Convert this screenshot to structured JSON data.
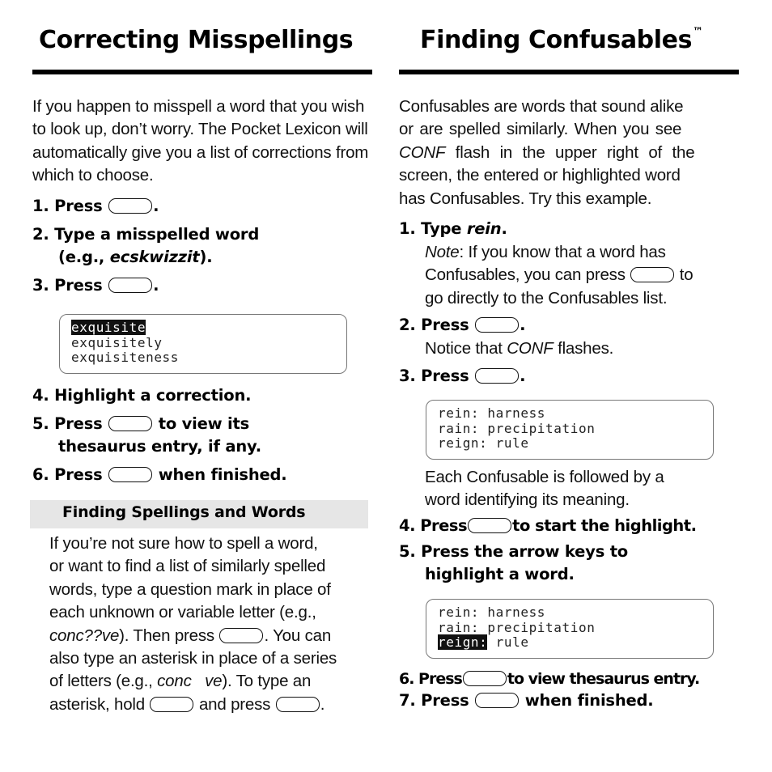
{
  "left": {
    "title": "Correcting Misspellings",
    "intro": "If you happen to misspell a word that you wish to look up, don’t worry. The Pocket Lexicon will automatically give you a list of corrections from which to choose.",
    "steps": {
      "s1_prefix": "1. Press",
      "s1_suffix": ".",
      "s2_line1": "2. Type a misspelled word",
      "s2_line2_prefix": "(e.g., ",
      "s2_line2_italic": "ecskwizzit",
      "s2_line2_suffix": ").",
      "s3_prefix": "3. Press",
      "s3_suffix": ".",
      "s4": "4. Highlight a correction.",
      "s5_prefix": "5. Press",
      "s5_suffix": "to view its",
      "s5_line2": "thesaurus entry, if any.",
      "s6_prefix": "6. Press",
      "s6_suffix": "when finished."
    },
    "screen": {
      "lines": [
        "exquisite",
        "exquisitely",
        "exquisiteness"
      ],
      "highlighted_index": 0
    },
    "subsection": {
      "title": "Finding Spellings and Words",
      "p1": "If you’re not sure how to spell a word,",
      "p2": "or want to find a list of similarly spelled",
      "p3": "words, type a question mark in place of",
      "p4": "each unknown or variable letter (e.g.,",
      "p5_italic": "conc??ve",
      "p5_mid": "). Then press",
      "p5_suffix": ". You can",
      "p6": "also type an asterisk in place of a series",
      "p7_prefix": "of letters (e.g., ",
      "p7_italic": "conc   ve",
      "p7_suffix": "). To type an",
      "p8_prefix": "asterisk, hold",
      "p8_mid": "and press",
      "p8_suffix": "."
    }
  },
  "right": {
    "title": "Finding Confusables",
    "trademark": "™",
    "intro_l1": "Confusables are words that sound alike",
    "intro_l2": "or are spelled similarly. When you see",
    "intro_l3_italic": "CONF",
    "intro_l3": " flash in the upper right of the",
    "intro_l4": "screen, the entered or highlighted word",
    "intro_l5": "has Confusables. Try this example.",
    "steps": {
      "s1_prefix": "1. Type ",
      "s1_italic": "rein",
      "s1_suffix": ".",
      "note_label": "Note",
      "note_l1": ": If you know that a word has",
      "note_l2_prefix": "Confusables, you can press",
      "note_l2_suffix": "to",
      "note_l3": "go directly to the Confusables list.",
      "s2_prefix": "2. Press",
      "s2_suffix": ".",
      "s2_note_prefix": "Notice that ",
      "s2_note_italic": "CONF",
      "s2_note_suffix": " flashes.",
      "s3_prefix": "3. Press",
      "s3_suffix": ".",
      "after_screen_l1": "Each Confusable is followed by a",
      "after_screen_l2": "word identifying its meaning.",
      "s4_prefix": "4. Press",
      "s4_suffix": "to start the highlight.",
      "s5_l1": "5. Press the arrow keys to",
      "s5_l2": "highlight a word.",
      "s6_prefix": "6. Press",
      "s6_suffix": "to view thesaurus entry.",
      "s7_prefix": "7. Press",
      "s7_suffix": "when finished."
    },
    "screen1": {
      "lines": [
        {
          "word": "rein:",
          "meaning": " harness"
        },
        {
          "word": "rain:",
          "meaning": " precipitation"
        },
        {
          "word": "reign:",
          "meaning": " rule"
        }
      ]
    },
    "screen2": {
      "lines": [
        {
          "word": "rein:",
          "meaning": " harness"
        },
        {
          "word": "rain:",
          "meaning": " precipitation"
        },
        {
          "word": "reign:",
          "meaning": " rule"
        }
      ],
      "highlighted_index": 2
    }
  }
}
